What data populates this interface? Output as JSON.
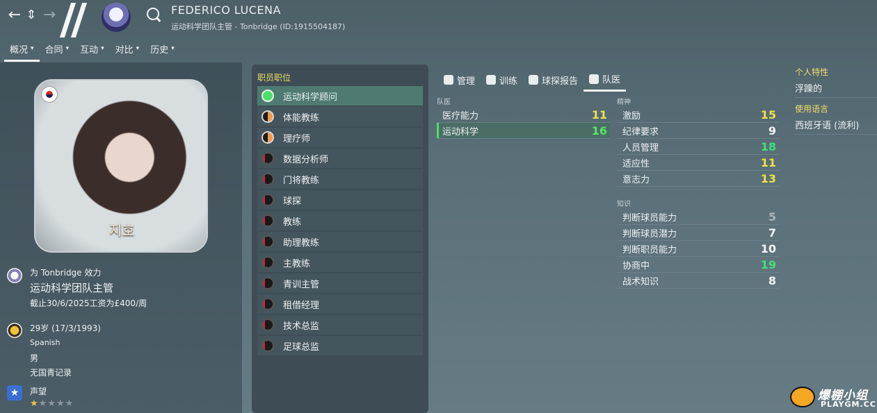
{
  "header": {
    "nav": {
      "back_icon": "←",
      "updown_icon": "⇕",
      "forward_icon": "→"
    },
    "name": "FEDERICO LUCENA",
    "subtitle": "运动科学团队主管 - Tonbridge (ID:1915504187)"
  },
  "tabs": [
    {
      "label": "概况",
      "active": true
    },
    {
      "label": "合同"
    },
    {
      "label": "互动"
    },
    {
      "label": "对比"
    },
    {
      "label": "历史"
    }
  ],
  "profile": {
    "photo_caption": "지호",
    "club_line": "为 Tonbridge 效力",
    "role": "运动科学团队主管",
    "contract": "截止30/6/2025工资为£400/周",
    "age": "29岁 (17/3/1993)",
    "nationality": "Spanish",
    "gender": "男",
    "youth_record": "无国青记录",
    "reputation_label": "声望",
    "reputation_stars": 1,
    "reputation_max": 5
  },
  "roles": {
    "title": "职员职位",
    "items": [
      {
        "label": "运动科学顾问",
        "level": "full",
        "active": true
      },
      {
        "label": "体能教练",
        "level": "half-orange"
      },
      {
        "label": "理疗师",
        "level": "half-orange"
      },
      {
        "label": "数据分析师",
        "level": "low"
      },
      {
        "label": "门将教练",
        "level": "low"
      },
      {
        "label": "球探",
        "level": "low"
      },
      {
        "label": "教练",
        "level": "low"
      },
      {
        "label": "助理教练",
        "level": "low"
      },
      {
        "label": "主教练",
        "level": "low"
      },
      {
        "label": "青训主管",
        "level": "low"
      },
      {
        "label": "租借经理",
        "level": "low"
      },
      {
        "label": "技术总监",
        "level": "low"
      },
      {
        "label": "足球总监",
        "level": "low"
      }
    ]
  },
  "attr_tabs": [
    {
      "label": "管理",
      "icon": "management-icon"
    },
    {
      "label": "训练",
      "icon": "training-icon"
    },
    {
      "label": "球探报告",
      "icon": "binoculars-icon"
    },
    {
      "label": "队医",
      "icon": "medical-icon",
      "active": true
    }
  ],
  "medical": {
    "title": "队医",
    "items": [
      {
        "name": "医疗能力",
        "value": "11",
        "color": "#e8e24a"
      },
      {
        "name": "运动科学",
        "value": "16",
        "color": "#5fe06a",
        "highlight": true
      }
    ]
  },
  "mental": {
    "title": "精神",
    "items": [
      {
        "name": "激励",
        "value": "15",
        "color": "#e8e24a"
      },
      {
        "name": "纪律要求",
        "value": "9",
        "color": "#f1f4f6"
      },
      {
        "name": "人员管理",
        "value": "18",
        "color": "#41e07a"
      },
      {
        "name": "适应性",
        "value": "11",
        "color": "#e8e24a"
      },
      {
        "name": "意志力",
        "value": "13",
        "color": "#e8e24a"
      }
    ]
  },
  "knowledge": {
    "title": "知识",
    "items": [
      {
        "name": "判断球员能力",
        "value": "5",
        "color": "#aab4b9"
      },
      {
        "name": "判断球员潜力",
        "value": "7",
        "color": "#f1f4f6"
      },
      {
        "name": "判断职员能力",
        "value": "10",
        "color": "#f1f4f6"
      },
      {
        "name": "协商中",
        "value": "19",
        "color": "#41e07a"
      },
      {
        "name": "战术知识",
        "value": "8",
        "color": "#f1f4f6"
      }
    ]
  },
  "side": {
    "traits_title": "个人特性",
    "traits_value": "浮躁的",
    "lang_title": "使用语言",
    "lang_value": "西班牙语 (流利)"
  },
  "watermark": {
    "word": "爆棚小组",
    "sub": "PLAYGM.CC",
    "mark": "gps"
  }
}
